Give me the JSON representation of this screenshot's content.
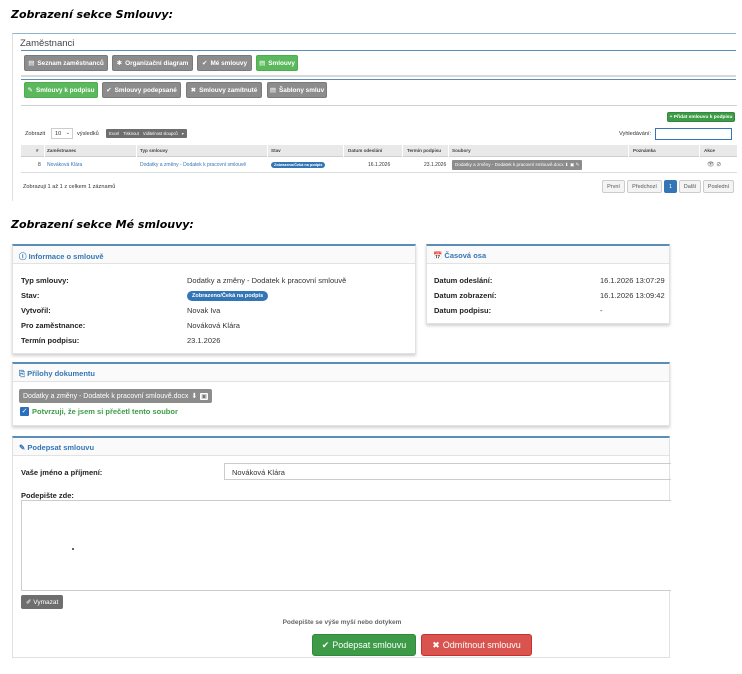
{
  "captions": {
    "smlouvy": "Zobrazení sekce Smlouvy:",
    "moje": "Zobrazení sekce Mé smlouvy:"
  },
  "screen1": {
    "title": "Zaměstnanci",
    "nav_buttons": [
      {
        "icon": "▤",
        "label": "Seznam zaměstnanců"
      },
      {
        "icon": "✱",
        "label": "Organizační diagram"
      },
      {
        "icon": "✔",
        "label": "Mé smlouvy"
      },
      {
        "icon": "▤",
        "label": "Smlouvy"
      }
    ],
    "sub_buttons": [
      {
        "icon": "✎",
        "label": "Smlouvy k podpisu"
      },
      {
        "icon": "✔",
        "label": "Smlouvy podepsané"
      },
      {
        "icon": "✖",
        "label": "Smlouvy zamítnuté"
      },
      {
        "icon": "▤",
        "label": "Šablony smluv"
      }
    ],
    "add_button": "+ Přidat smlouvu k podpisu",
    "show_label": "Zobrazit",
    "show_value": "10",
    "results_label": "výsledků",
    "export_buttons": [
      "Excel",
      "Tisknout",
      "Viditelnost sloupců"
    ],
    "search_label": "Vyhledávání:",
    "columns": [
      "#",
      "Zaměstnanec",
      "Typ smlouvy",
      "Stav",
      "Datum odeslání",
      "Termín podpisu",
      "Soubory",
      "Poznámka",
      "Akce"
    ],
    "row": {
      "num": "8",
      "employee": "Nováková Klára",
      "type": "Dodatky a změny - Dodatek k pracovní smlouvě",
      "status": "Zobrazeno/Čeká na podpis",
      "sent": "16.1.2026",
      "deadline": "23.1.2026",
      "file": "Dodatky a změny - Dodatek k pracovní smlouvě.docx",
      "actions": "👁 ⊘"
    },
    "info": "Zobrazuji 1 až 1 z celkem 1 záznamů",
    "pagination": [
      "První",
      "Předchozí",
      "1",
      "Další",
      "Poslední"
    ]
  },
  "screen2": {
    "info_panel": {
      "title": "ⓘ Informace o smlouvě",
      "rows": [
        {
          "label": "Typ smlouvy:",
          "value": "Dodatky a změny - Dodatek k pracovní smlouvě"
        },
        {
          "label": "Stav:",
          "value": "Zobrazeno/Čeká na podpis"
        },
        {
          "label": "Vytvořil:",
          "value": "Novak Iva"
        },
        {
          "label": "Pro zaměstnance:",
          "value": "Nováková Klára"
        },
        {
          "label": "Termín podpisu:",
          "value": "23.1.2026"
        }
      ]
    },
    "timeline_panel": {
      "title": "📅 Časová osa",
      "rows": [
        {
          "label": "Datum odeslání:",
          "value": "16.1.2026 13:07:29"
        },
        {
          "label": "Datum zobrazení:",
          "value": "16.1.2026 13:09:42"
        },
        {
          "label": "Datum podpisu:",
          "value": "-"
        }
      ]
    },
    "attachments_panel": {
      "title": "⎘ Přílohy dokumentu",
      "file": "Dodatky a změny - Dodatek k pracovní smlouvě.docx",
      "confirm": "Potvrzuji, že jsem si přečetl tento soubor"
    },
    "sign_panel": {
      "title": "✎ Podepsat smlouvu",
      "name_label": "Vaše jméno a příjmení:",
      "name_value": "Nováková Klára",
      "sign_label": "Podepište zde:",
      "clear_button": "Vymazat",
      "hint": "Podepište se výše myší nebo dotykem",
      "sign_button": "Podepsat smlouvu",
      "reject_button": "Odmítnout smlouvu"
    }
  },
  "colors": {
    "accent": "#3476b5",
    "success": "#5cb85c",
    "danger": "#d9534f"
  }
}
